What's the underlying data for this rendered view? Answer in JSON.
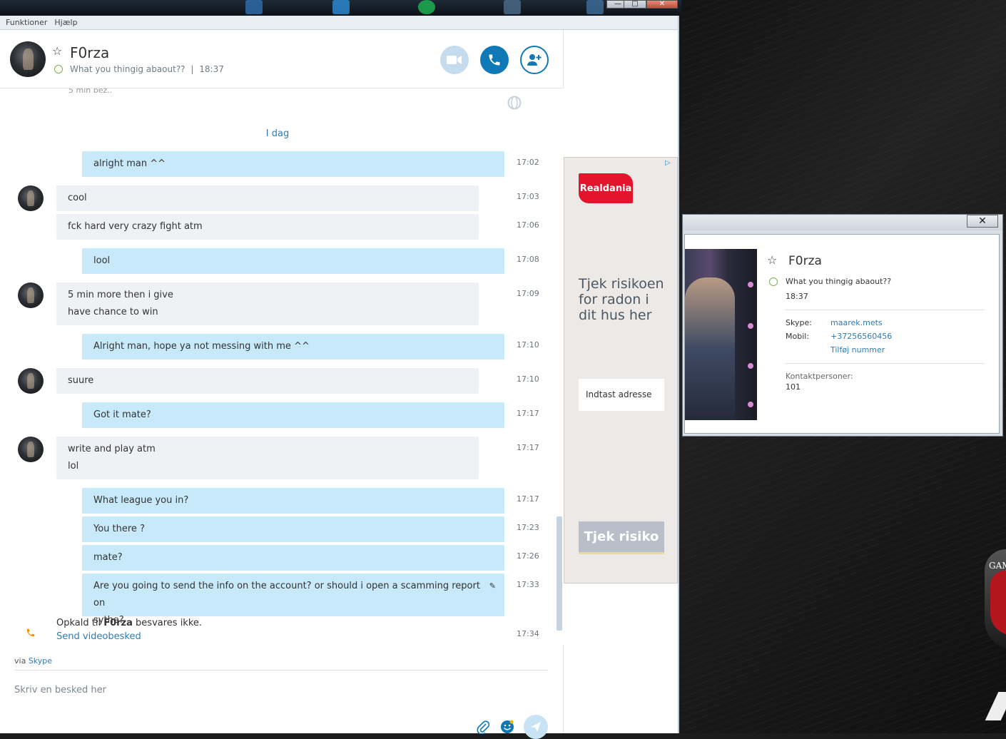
{
  "menu": {
    "items": [
      "Funktioner",
      "Hjælp"
    ]
  },
  "header": {
    "name": "F0rza",
    "mood": "What you thingig abaout??",
    "separator": "|",
    "time": "18:37"
  },
  "chat": {
    "partial_top": "5 min bez..",
    "day_label": "I dag",
    "messages": [
      {
        "dir": "out",
        "lines": [
          "alright man ^^"
        ],
        "time": "17:02"
      },
      {
        "dir": "in",
        "avatar": true,
        "lines": [
          "cool"
        ],
        "time": "17:03"
      },
      {
        "dir": "in",
        "avatar": false,
        "lines": [
          "fck hard very crazy fight atm"
        ],
        "time": "17:06"
      },
      {
        "dir": "out",
        "lines": [
          "lool"
        ],
        "time": "17:08"
      },
      {
        "dir": "in",
        "avatar": true,
        "lines": [
          "5 min more then i give",
          "have chance to win"
        ],
        "time": "17:09"
      },
      {
        "dir": "out",
        "lines": [
          "Alright man, hope ya not messing with me ^^"
        ],
        "time": "17:10"
      },
      {
        "dir": "in",
        "avatar": true,
        "lines": [
          "suure"
        ],
        "time": "17:10"
      },
      {
        "dir": "out",
        "lines": [
          "Got it mate?"
        ],
        "time": "17:17"
      },
      {
        "dir": "in",
        "avatar": true,
        "lines": [
          "write and play atm",
          "lol"
        ],
        "time": "17:17"
      },
      {
        "dir": "out",
        "lines": [
          "What league you in?"
        ],
        "time": "17:17"
      },
      {
        "dir": "out",
        "lines": [
          "You there ?"
        ],
        "time": "17:23"
      },
      {
        "dir": "out",
        "lines": [
          "mate?"
        ],
        "time": "17:26"
      },
      {
        "dir": "out",
        "lines": [
          "Are you going to send the info on the account? or should i open a scamming report on",
          "sythe?"
        ],
        "time": "17:33",
        "edited": true
      }
    ],
    "missed_call": {
      "prefix": "Opkald til",
      "name": "F0rza",
      "suffix": "besvares ikke.",
      "link": "Send videobesked",
      "time": "17:34"
    }
  },
  "composer": {
    "via_prefix": "via",
    "via_link": "Skype",
    "placeholder": "Skriv en besked her"
  },
  "ad": {
    "brand": "Realdania",
    "headline": "Tjek risikoen for radon i dit hus her",
    "field_placeholder": "Indtast adresse",
    "button": "Tjek risiko"
  },
  "profile": {
    "name": "F0rza",
    "mood": "What you thingig abaout??",
    "time": "18:37",
    "skype_label": "Skype:",
    "skype_value": "maarek.mets",
    "mobile_label": "Mobil:",
    "mobile_value": "+37256560456",
    "add_number": "Tilføj nummer",
    "contacts_label": "Kontaktpersoner:",
    "contacts_value": "101"
  },
  "desktop": {
    "logo_text": "GAM"
  },
  "colors": {
    "accent": "#0f78b6",
    "bubble_out": "#c7e9f9",
    "bubble_in": "#eff1f4",
    "presence": "#7cb342",
    "ad_red": "#e3142b",
    "missed_call": "#f29100"
  },
  "icons": [
    "star-icon",
    "video-call-icon",
    "phone-icon",
    "add-contact-icon",
    "globe-icon",
    "phone-missed-icon",
    "attach-icon",
    "emoji-icon",
    "send-icon",
    "close-icon",
    "edit-icon",
    "adchoices-icon"
  ]
}
